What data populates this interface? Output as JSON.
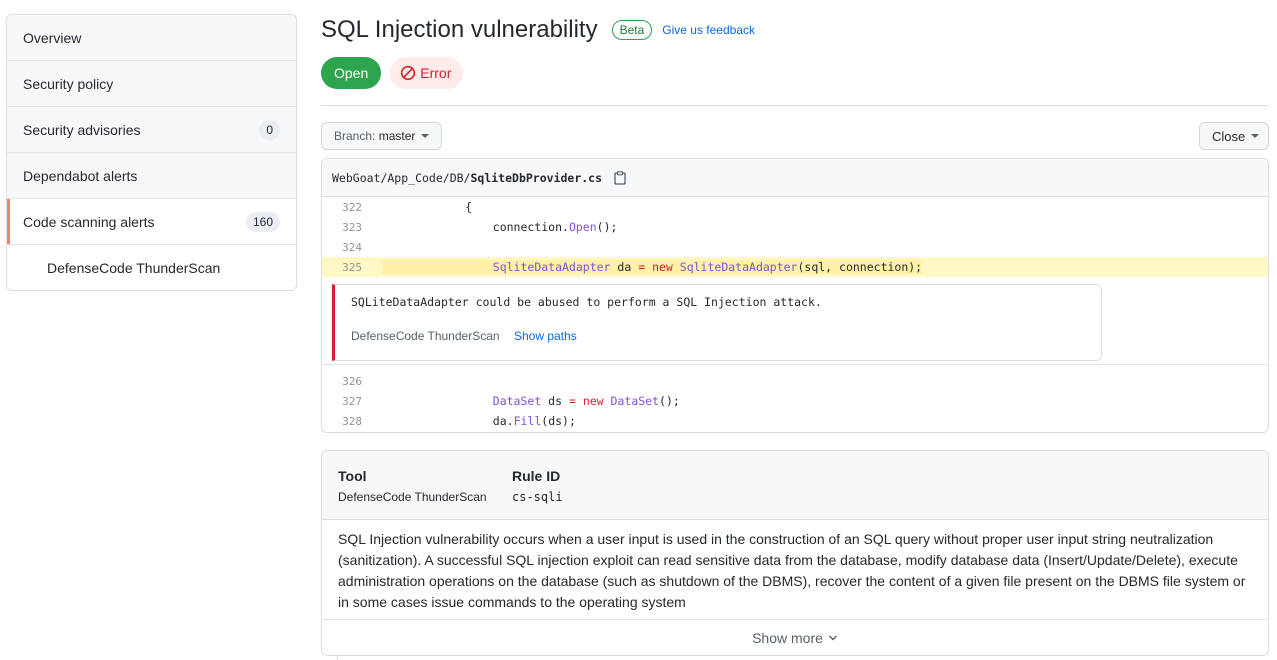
{
  "sidebar": {
    "items": [
      {
        "label": "Overview"
      },
      {
        "label": "Security policy"
      },
      {
        "label": "Security advisories",
        "count": "0"
      },
      {
        "label": "Dependabot alerts"
      },
      {
        "label": "Code scanning alerts",
        "count": "160",
        "active": true
      },
      {
        "label": "DefenseCode ThunderScan",
        "sub": true
      }
    ]
  },
  "header": {
    "title": "SQL Injection vulnerability",
    "beta_label": "Beta",
    "feedback_link": "Give us feedback",
    "state_label": "Open",
    "severity_label": "Error",
    "state_color": "#2da44e",
    "severity_color": "#cf222e"
  },
  "toolbar": {
    "branch_prefix": "Branch:",
    "branch_value": "master",
    "close_label": "Close"
  },
  "code": {
    "file_path_dir": "WebGoat/App_Code/DB/",
    "file_name": "SqliteDbProvider.cs",
    "copy_icon": "clipboard-icon",
    "lines_before": [
      {
        "num": "322",
        "text": "            {"
      },
      {
        "num": "323",
        "pre": "                connection.",
        "fn": "Open",
        "post": "();"
      },
      {
        "num": "324",
        "text": ""
      },
      {
        "num": "325",
        "highlighted": true
      }
    ],
    "highlight_line": {
      "t1": "SqliteDataAdapter",
      "t2": " da ",
      "t3": "=",
      "t4": " ",
      "t5": "new",
      "t6": " ",
      "t7": "SqliteDataAdapter",
      "t8": "(sql, connection);"
    },
    "alert": {
      "message": "SQLiteDataAdapter could be abused to perform a SQL Injection attack.",
      "tool": "DefenseCode ThunderScan",
      "link": "Show paths"
    },
    "lines_after": [
      {
        "num": "326"
      },
      {
        "num": "327",
        "ty1": "DataSet",
        "mid": " ds ",
        "eq": "=",
        "kw": "new",
        "ty2": "DataSet",
        "end": "();"
      },
      {
        "num": "328",
        "pre": "da.",
        "fn": "Fill",
        "post": "(ds);"
      }
    ]
  },
  "details": {
    "tool_label": "Tool",
    "tool_value": "DefenseCode ThunderScan",
    "rule_label": "Rule ID",
    "rule_value": "cs-sqli",
    "description": "SQL Injection vulnerability occurs when a user input is used in the construction of an SQL query without proper user input string neutralization (sanitization). A successful SQL injection exploit can read sensitive data from the database, modify database data (Insert/Update/Delete), execute administration operations on the database (such as shutdown of the DBMS), recover the content of a given file present on the DBMS file system or in some cases issue commands to the operating system",
    "show_more": "Show more"
  }
}
